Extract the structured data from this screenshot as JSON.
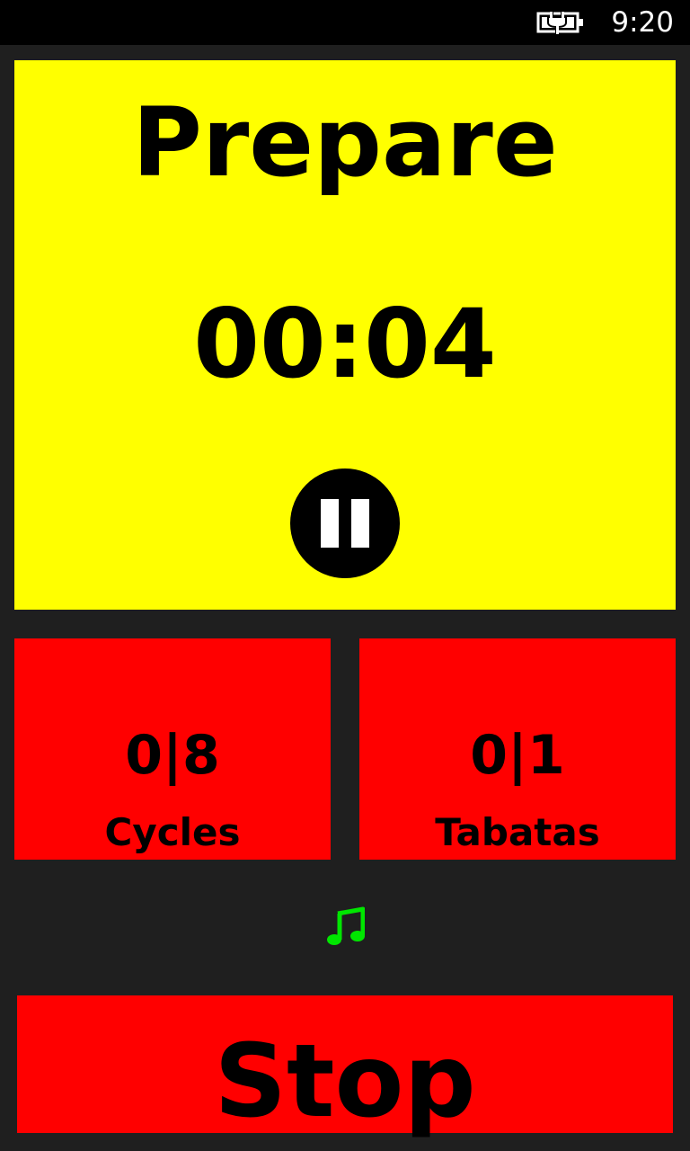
{
  "status_bar": {
    "time": "9:20",
    "battery_icon": "battery-charging-icon"
  },
  "phase": {
    "label": "Prepare",
    "timer": "00:04",
    "color": "#ffff00",
    "pause_icon": "pause-icon"
  },
  "counters": {
    "cycles": {
      "value": "0|8",
      "label": "Cycles"
    },
    "tabatas": {
      "value": "0|1",
      "label": "Tabatas"
    },
    "color": "#ff0000"
  },
  "music": {
    "icon": "music-note-icon",
    "color": "#00e600"
  },
  "stop": {
    "label": "Stop",
    "color": "#ff0000"
  }
}
